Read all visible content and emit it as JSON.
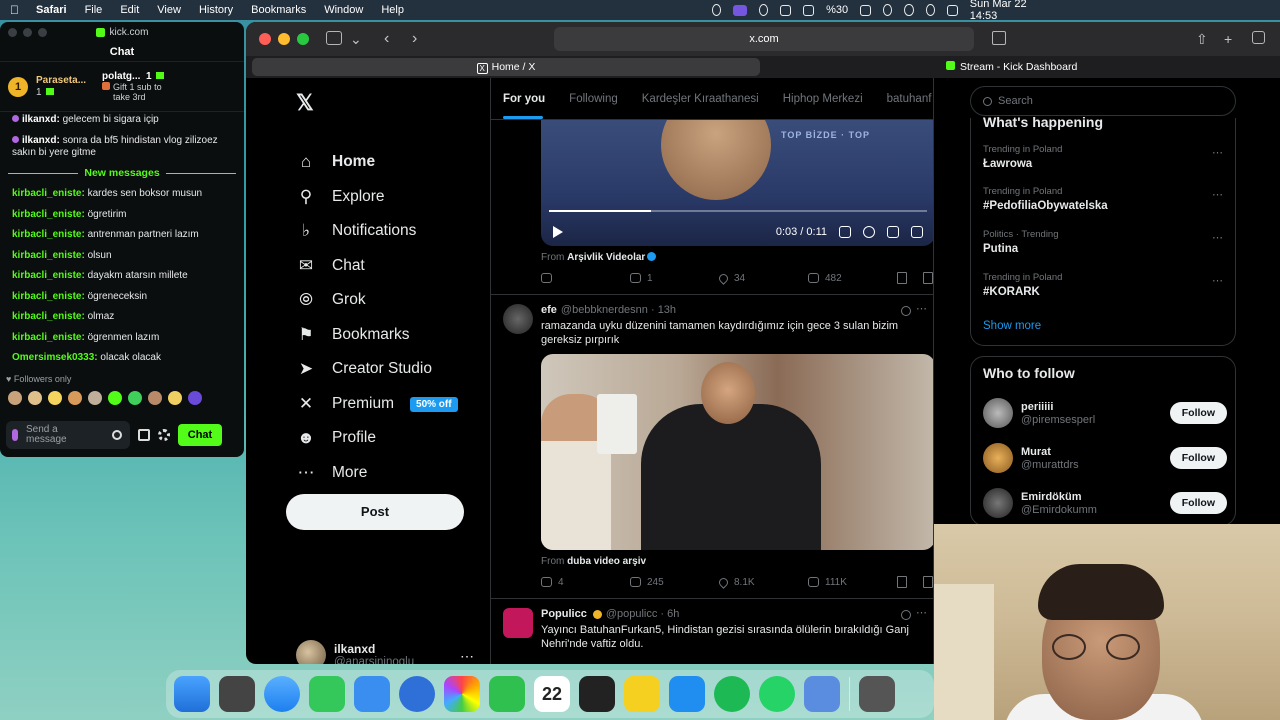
{
  "menubar": {
    "app": "Safari",
    "items": [
      "File",
      "Edit",
      "View",
      "History",
      "Bookmarks",
      "Window",
      "Help"
    ],
    "battery": "%30",
    "datetime": "Sun Mar 22  14:53"
  },
  "kick": {
    "url": "kick.com",
    "chat_title": "Chat",
    "pinned1_rank": "1",
    "pinned1_name": "Paraseta...",
    "pinned1_count": "1",
    "pinned2_name": "polatg...",
    "pinned2_count": "1",
    "pinned2_sub": "Gift 1 sub to",
    "pinned2_sub2": "take 3rd",
    "messages": [
      {
        "user": "ilkanxd:",
        "text": "gelecem bi sigara içip"
      },
      {
        "user": "ilkanxd:",
        "text": "sonra da bf5 hindistan vlog zilizoez sakın bi yere gitme"
      }
    ],
    "new_messages_label": "New messages",
    "messages2": [
      {
        "user": "kirbacli_eniste:",
        "text": "kardes sen boksor musun"
      },
      {
        "user": "kirbacli_eniste:",
        "text": "ögretirim"
      },
      {
        "user": "kirbacli_eniste:",
        "text": "antrenman partneri lazım"
      },
      {
        "user": "kirbacli_eniste:",
        "text": "olsun"
      },
      {
        "user": "kirbacli_eniste:",
        "text": "dayakm atarsın millete"
      },
      {
        "user": "kirbacli_eniste:",
        "text": "ögreneceksin"
      },
      {
        "user": "kirbacli_eniste:",
        "text": "olmaz"
      },
      {
        "user": "kirbacli_eniste:",
        "text": "ögrenmen lazım"
      },
      {
        "user": "Omersimsek0333:",
        "text": "olacak olacak"
      }
    ],
    "followers_only": "Followers only",
    "input_placeholder_1": "Send a",
    "input_placeholder_2": "message",
    "chat_button": "Chat"
  },
  "safari": {
    "address": "x.com",
    "tab_active": "Home / X",
    "tab_other": "Stream - Kick Dashboard"
  },
  "x": {
    "nav": [
      {
        "label": "Home",
        "icon": "home-icon"
      },
      {
        "label": "Explore",
        "icon": "search-icon"
      },
      {
        "label": "Notifications",
        "icon": "bell-icon"
      },
      {
        "label": "Chat",
        "icon": "mail-icon"
      },
      {
        "label": "Grok",
        "icon": "grok-icon"
      },
      {
        "label": "Bookmarks",
        "icon": "bookmark-icon"
      },
      {
        "label": "Creator Studio",
        "icon": "rocket-icon"
      },
      {
        "label": "Premium",
        "icon": "x-icon"
      },
      {
        "label": "Profile",
        "icon": "person-icon"
      },
      {
        "label": "More",
        "icon": "more-icon"
      }
    ],
    "premium_badge": "50% off",
    "post_button": "Post",
    "account_name": "ilkanxd",
    "account_handle": "@anarsininoglu",
    "feed_tabs": [
      "For you",
      "Following",
      "Kardeşler Kıraathanesi",
      "Hiphop Merkezi",
      "batuhanf"
    ],
    "video1": {
      "ticker": "TOP BİZDE · TOP",
      "time": "0:03 / 0:11",
      "progress": 0.27,
      "from_label": "From",
      "from_name": "Arşivlik Videolar",
      "replies": "",
      "reposts": "1",
      "likes": "34",
      "views": "482"
    },
    "tweet2": {
      "name": "efe",
      "handle": "@bebbknerdesnn · 13h",
      "text": "ramazanda uyku düzenini tamamen kaydırdığımız için gece 3 sulan bizim gereksiz pırpırık",
      "from_label": "From",
      "from_name": "duba video arşiv",
      "replies": "4",
      "reposts": "245",
      "likes": "8.1K",
      "views": "111K"
    },
    "tweet3": {
      "name": "Populicc",
      "handle": "@populicc · 6h",
      "text": "Yayıncı BatuhanFurkan5, Hindistan gezisi sırasında ölülerin bırakıldığı Ganj Nehri'nde vaftiz oldu."
    },
    "search_placeholder": "Search",
    "happening_title": "What's happening",
    "trends": [
      {
        "context": "Trending in Poland",
        "title": "Ławrowa"
      },
      {
        "context": "Trending in Poland",
        "title": "#PedofiliaObywatelska"
      },
      {
        "context": "Politics · Trending",
        "title": "Putina"
      },
      {
        "context": "Trending in Poland",
        "title": "#KORARK"
      }
    ],
    "show_more": "Show more",
    "wtf_title": "Who to follow",
    "follow_label": "Follow",
    "who_to_follow": [
      {
        "name": "periiiii",
        "handle": "@piremsesperl"
      },
      {
        "name": "Murat",
        "handle": "@murattdrs"
      },
      {
        "name": "Emirdöküm",
        "handle": "@Emirdokumm"
      }
    ]
  },
  "dock": {
    "calendar_day": "22"
  },
  "colors": {
    "kick_green": "#53fc18",
    "x_blue": "#1d9bf0",
    "x_bg": "#000000"
  }
}
